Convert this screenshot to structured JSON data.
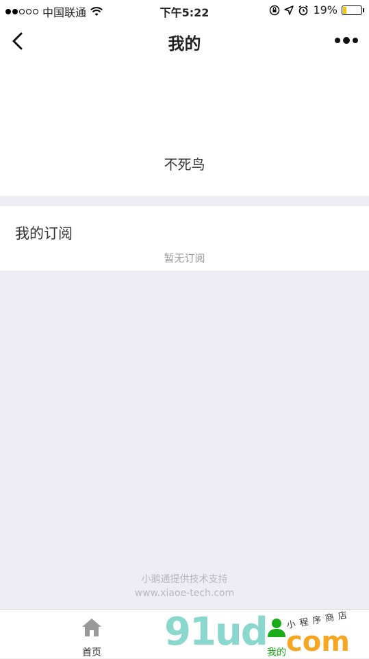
{
  "status_bar": {
    "carrier": "中国联通",
    "time": "下午5:22",
    "battery": "19%",
    "battery_level": 0.19,
    "icons": [
      "signal-dots",
      "wifi-icon",
      "rotation-lock-icon",
      "location-icon",
      "alarm-icon",
      "battery-icon"
    ]
  },
  "nav": {
    "title": "我的",
    "back_icon": "chevron-left-icon",
    "more_icon": "more-dots-icon"
  },
  "profile": {
    "nickname": "不死鸟"
  },
  "subscriptions": {
    "title": "我的订阅",
    "empty_text": "暂无订阅"
  },
  "footer": {
    "support_text": "小鹅通提供技术支持",
    "support_url": "www.xiaoe-tech.com"
  },
  "tabs": [
    {
      "label": "首页",
      "icon": "home-icon",
      "active": false
    },
    {
      "label": "我的",
      "icon": "person-icon",
      "active": true
    }
  ],
  "colors": {
    "accent": "#1aad19",
    "background": "#efedf4",
    "inactive_icon": "#999999"
  },
  "watermark": {
    "main": "91ud",
    "suffix": "com",
    "tagline": "小程序商店"
  }
}
